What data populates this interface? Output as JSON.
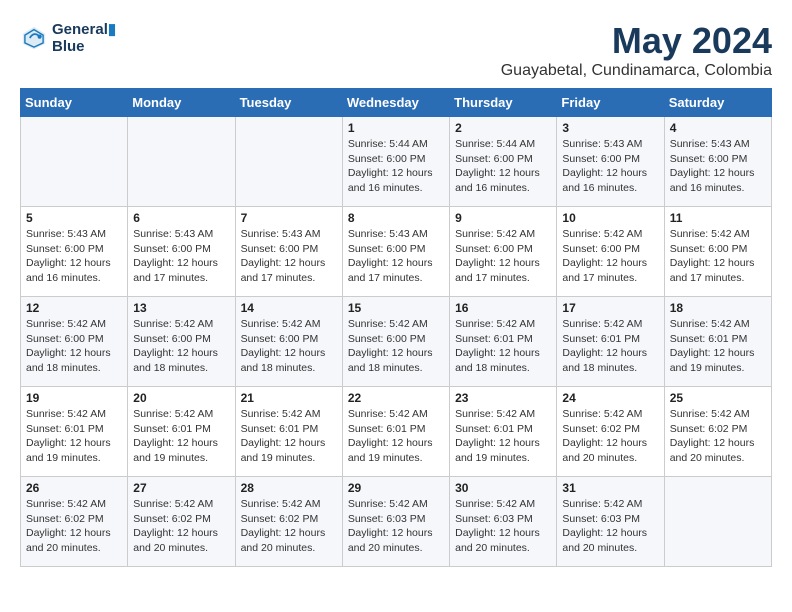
{
  "header": {
    "logo_line1": "General",
    "logo_line2": "Blue",
    "month": "May 2024",
    "location": "Guayabetal, Cundinamarca, Colombia"
  },
  "days_of_week": [
    "Sunday",
    "Monday",
    "Tuesday",
    "Wednesday",
    "Thursday",
    "Friday",
    "Saturday"
  ],
  "weeks": [
    [
      {
        "day": "",
        "info": ""
      },
      {
        "day": "",
        "info": ""
      },
      {
        "day": "",
        "info": ""
      },
      {
        "day": "1",
        "info": "Sunrise: 5:44 AM\nSunset: 6:00 PM\nDaylight: 12 hours\nand 16 minutes."
      },
      {
        "day": "2",
        "info": "Sunrise: 5:44 AM\nSunset: 6:00 PM\nDaylight: 12 hours\nand 16 minutes."
      },
      {
        "day": "3",
        "info": "Sunrise: 5:43 AM\nSunset: 6:00 PM\nDaylight: 12 hours\nand 16 minutes."
      },
      {
        "day": "4",
        "info": "Sunrise: 5:43 AM\nSunset: 6:00 PM\nDaylight: 12 hours\nand 16 minutes."
      }
    ],
    [
      {
        "day": "5",
        "info": "Sunrise: 5:43 AM\nSunset: 6:00 PM\nDaylight: 12 hours\nand 16 minutes."
      },
      {
        "day": "6",
        "info": "Sunrise: 5:43 AM\nSunset: 6:00 PM\nDaylight: 12 hours\nand 17 minutes."
      },
      {
        "day": "7",
        "info": "Sunrise: 5:43 AM\nSunset: 6:00 PM\nDaylight: 12 hours\nand 17 minutes."
      },
      {
        "day": "8",
        "info": "Sunrise: 5:43 AM\nSunset: 6:00 PM\nDaylight: 12 hours\nand 17 minutes."
      },
      {
        "day": "9",
        "info": "Sunrise: 5:42 AM\nSunset: 6:00 PM\nDaylight: 12 hours\nand 17 minutes."
      },
      {
        "day": "10",
        "info": "Sunrise: 5:42 AM\nSunset: 6:00 PM\nDaylight: 12 hours\nand 17 minutes."
      },
      {
        "day": "11",
        "info": "Sunrise: 5:42 AM\nSunset: 6:00 PM\nDaylight: 12 hours\nand 17 minutes."
      }
    ],
    [
      {
        "day": "12",
        "info": "Sunrise: 5:42 AM\nSunset: 6:00 PM\nDaylight: 12 hours\nand 18 minutes."
      },
      {
        "day": "13",
        "info": "Sunrise: 5:42 AM\nSunset: 6:00 PM\nDaylight: 12 hours\nand 18 minutes."
      },
      {
        "day": "14",
        "info": "Sunrise: 5:42 AM\nSunset: 6:00 PM\nDaylight: 12 hours\nand 18 minutes."
      },
      {
        "day": "15",
        "info": "Sunrise: 5:42 AM\nSunset: 6:00 PM\nDaylight: 12 hours\nand 18 minutes."
      },
      {
        "day": "16",
        "info": "Sunrise: 5:42 AM\nSunset: 6:01 PM\nDaylight: 12 hours\nand 18 minutes."
      },
      {
        "day": "17",
        "info": "Sunrise: 5:42 AM\nSunset: 6:01 PM\nDaylight: 12 hours\nand 18 minutes."
      },
      {
        "day": "18",
        "info": "Sunrise: 5:42 AM\nSunset: 6:01 PM\nDaylight: 12 hours\nand 19 minutes."
      }
    ],
    [
      {
        "day": "19",
        "info": "Sunrise: 5:42 AM\nSunset: 6:01 PM\nDaylight: 12 hours\nand 19 minutes."
      },
      {
        "day": "20",
        "info": "Sunrise: 5:42 AM\nSunset: 6:01 PM\nDaylight: 12 hours\nand 19 minutes."
      },
      {
        "day": "21",
        "info": "Sunrise: 5:42 AM\nSunset: 6:01 PM\nDaylight: 12 hours\nand 19 minutes."
      },
      {
        "day": "22",
        "info": "Sunrise: 5:42 AM\nSunset: 6:01 PM\nDaylight: 12 hours\nand 19 minutes."
      },
      {
        "day": "23",
        "info": "Sunrise: 5:42 AM\nSunset: 6:01 PM\nDaylight: 12 hours\nand 19 minutes."
      },
      {
        "day": "24",
        "info": "Sunrise: 5:42 AM\nSunset: 6:02 PM\nDaylight: 12 hours\nand 20 minutes."
      },
      {
        "day": "25",
        "info": "Sunrise: 5:42 AM\nSunset: 6:02 PM\nDaylight: 12 hours\nand 20 minutes."
      }
    ],
    [
      {
        "day": "26",
        "info": "Sunrise: 5:42 AM\nSunset: 6:02 PM\nDaylight: 12 hours\nand 20 minutes."
      },
      {
        "day": "27",
        "info": "Sunrise: 5:42 AM\nSunset: 6:02 PM\nDaylight: 12 hours\nand 20 minutes."
      },
      {
        "day": "28",
        "info": "Sunrise: 5:42 AM\nSunset: 6:02 PM\nDaylight: 12 hours\nand 20 minutes."
      },
      {
        "day": "29",
        "info": "Sunrise: 5:42 AM\nSunset: 6:03 PM\nDaylight: 12 hours\nand 20 minutes."
      },
      {
        "day": "30",
        "info": "Sunrise: 5:42 AM\nSunset: 6:03 PM\nDaylight: 12 hours\nand 20 minutes."
      },
      {
        "day": "31",
        "info": "Sunrise: 5:42 AM\nSunset: 6:03 PM\nDaylight: 12 hours\nand 20 minutes."
      },
      {
        "day": "",
        "info": ""
      }
    ]
  ]
}
